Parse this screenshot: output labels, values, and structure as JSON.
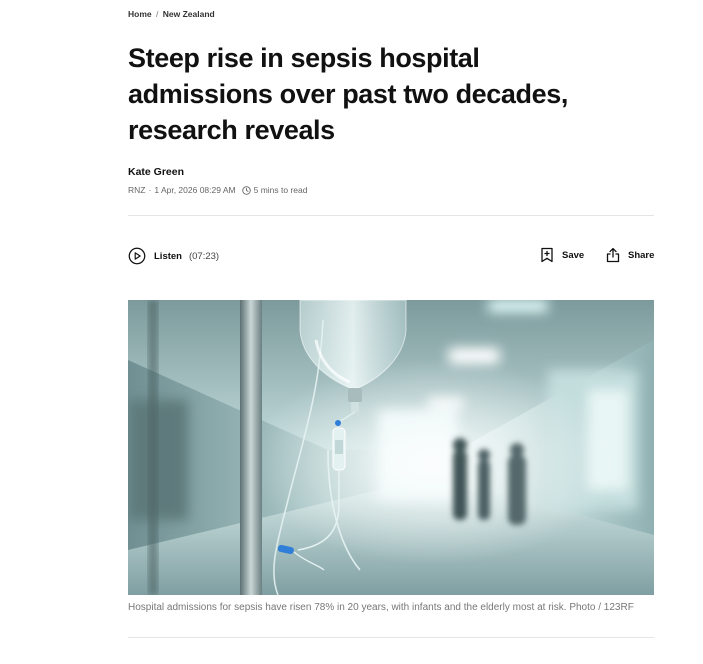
{
  "breadcrumb": {
    "home": "Home",
    "separator": "/",
    "section": "New Zealand"
  },
  "article": {
    "headline": "Steep rise in sepsis hospital admissions over past two decades, research reveals",
    "author": "Kate Green",
    "source": "RNZ",
    "meta_separator": "·",
    "published": "1 Apr, 2026 08:29 AM",
    "read_time": "5 mins to read"
  },
  "toolbar": {
    "listen_label": "Listen",
    "listen_duration": "(07:23)",
    "save_label": "Save",
    "share_label": "Share"
  },
  "image": {
    "alt": "IV drip bag hanging in a blurred hospital corridor",
    "caption": "Hospital admissions for sepsis have risen 78% in 20 years, with infants and the elderly most at risk. Photo / 123RF"
  },
  "colors": {
    "text": "#111111",
    "muted": "#666666",
    "caption": "#777777",
    "divider": "#e5e5e5",
    "image_tint": "#bfd7d6"
  },
  "icons": {
    "play": "play-circle-icon",
    "clock": "clock-icon",
    "save": "bookmark-plus-icon",
    "share": "share-icon"
  }
}
